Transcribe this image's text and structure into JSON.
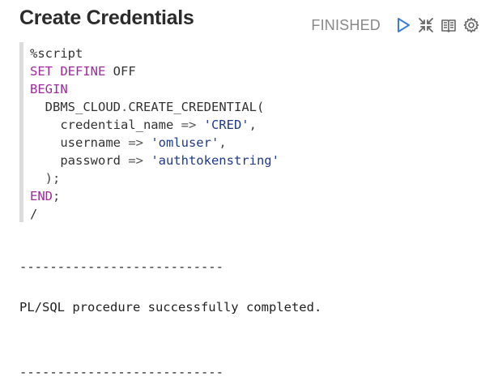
{
  "paragraph": {
    "title": "Create Credentials",
    "status": "FINISHED",
    "icons": [
      "run-icon",
      "collapse-icon",
      "book-icon",
      "gear-icon"
    ]
  },
  "editor": {
    "line1": "%script",
    "line2_kw": "SET DEFINE",
    "line2_rest": " OFF",
    "line3": "BEGIN",
    "line4_fn": "DBMS_CLOUD",
    "line4_dot": ".",
    "line4_proc": "CREATE_CREDENTIAL(",
    "arg1_name": "credential_name",
    "arg1_op": " => ",
    "arg1_val": "'CRED'",
    "arg1_comma": ",",
    "arg2_name": "username",
    "arg2_op": " => ",
    "arg2_val": "'omluser'",
    "arg2_comma": ",",
    "arg3_name": "password",
    "arg3_op": " => ",
    "arg3_val": "'authtokenstring'",
    "close_paren": ");",
    "end_kw": "END",
    "end_semicolon": ";",
    "slash": "/"
  },
  "output": {
    "separator1": "---------------------------",
    "message": "PL/SQL procedure successfully completed.",
    "separator2": "---------------------------"
  },
  "colors": {
    "keyword": "#a0299e",
    "string": "#1e3a8a",
    "status": "#888888",
    "run_icon": "#3b7dd8"
  }
}
